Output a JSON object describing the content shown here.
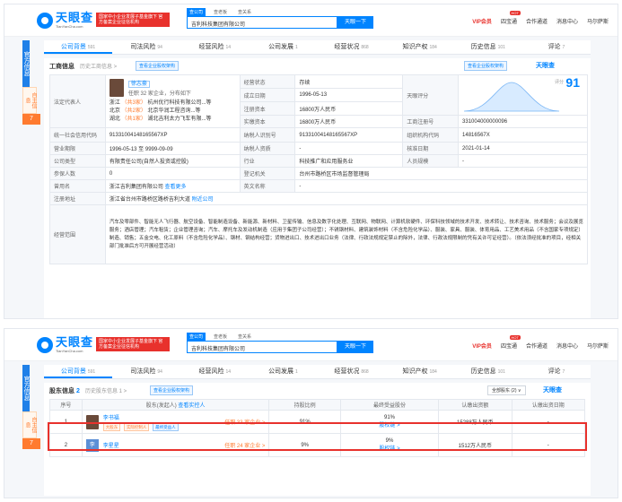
{
  "header": {
    "logo_name": "天眼查",
    "logo_domain": "TianYanCha.com",
    "promo": "国家中小企业发展子基金旗下 官方备案企业征信机构",
    "search_tabs": [
      "查公司",
      "查老板",
      "查关系"
    ],
    "search_value": "吉利科技集团有限公司",
    "search_btn": "天眼一下",
    "vip": "VIP会员",
    "nav": [
      "四宝通",
      "合作通道",
      "消息中心",
      "马尔萨斯"
    ],
    "hot": "HOT"
  },
  "side": {
    "a": "官方信息",
    "b": "自主信息",
    "c": "7"
  },
  "tabs1": [
    {
      "label": "公司背景",
      "n": "591"
    },
    {
      "label": "司法风险",
      "n": "94"
    },
    {
      "label": "经营风险",
      "n": "14"
    },
    {
      "label": "公司发展",
      "n": "1"
    },
    {
      "label": "经营状况",
      "n": "868"
    },
    {
      "label": "知识产权",
      "n": "184"
    },
    {
      "label": "历史信息",
      "n": "101"
    },
    {
      "label": "评论",
      "n": "7"
    }
  ],
  "biz": {
    "title": "工商信息",
    "history": "历史工商信息 >",
    "report_tag": "查看企业股权架构",
    "tyc": "天眼查",
    "legal_label": "法定代表人",
    "legal_name": "徐志豪",
    "legal_desc": "任职 32 家企业，分布如下",
    "legal_rows": [
      [
        "浙江",
        "（共3家）",
        "杭州优行科技有限公司...等"
      ],
      [
        "北京",
        "（共2家）",
        "北京华润工程咨询...等"
      ],
      [
        "湖北",
        "（共1家）",
        "湖北吉利太力飞车有限...等"
      ]
    ],
    "status_k": "经营状态",
    "status_v": "存续",
    "found_k": "成立日期",
    "found_v": "1996-05-13",
    "reg_cap_k": "注册资本",
    "reg_cap_v": "16800万人民币",
    "paid_cap_k": "实缴资本",
    "paid_cap_v": "16800万人民币",
    "score_k": "天眼评分",
    "score_lbl": "评分",
    "score_v": "91",
    "reg_no_k": "工商注册号",
    "reg_no_v": "331004000000096",
    "credit_k": "统一社会信用代码",
    "credit_v": "91331004148165567XP",
    "tax_k": "纳税人识别号",
    "tax_v": "91331004148165567XP",
    "org_k": "组织机构代码",
    "org_v": "14816567X",
    "term_k": "营业期限",
    "term_v": "1996-05-13 至 9999-09-09",
    "taxq_k": "纳税人资质",
    "taxq_v": "-",
    "approve_k": "核准日期",
    "approve_v": "2021-01-14",
    "type_k": "公司类型",
    "type_v": "有限责任公司(自然人投资或控股)",
    "ind_k": "行业",
    "ind_v": "科技推广和应用服务业",
    "staff_k": "人员规模",
    "staff_v": "-",
    "ins_k": "参保人数",
    "ins_v": "0",
    "auth_k": "登记机关",
    "auth_v": "台州市路桥区市场监督管理局",
    "former_k": "曾用名",
    "former_v": "浙江吉利集团有限公司",
    "former_more": "查看更多",
    "en_k": "英文名称",
    "en_v": "-",
    "addr_k": "注册地址",
    "addr_v": "浙江省台州市路桥区路桥吉利大道",
    "addr_link": "附近公司",
    "scope_k": "经营范围",
    "scope_v": "汽车及零部件、智能无人飞行器、航空设备、智能制造设备、新能源、新材料、卫星传输、信息及数字化处理、互联网、物联网、计算机软硬件、环保科技领域的技术开发、技术转让、技术咨询、技术服务；会议及展览服务；酒店管理；汽车租赁；企业管理咨询；汽车、摩托车及发动机制造（应用于集团子公司经营）；不锈钢材料、建筑装饰材料（不含危险化学品）、服装、家具、服装、体育用品、工艺美术用品（不含国家专项规定）制造、销售；五金交电、化工原料（不含危险化学品）、钢材、钢结构经营；货物进出口、技术进出口业务（法律、行政法规规定禁止的除外，法律、行政法规限制的凭有关许可证经营）。（依法须经批准的项目，经相关部门批准后方可开展经营活动）"
  },
  "shareholders": {
    "title": "股东信息",
    "count": "2",
    "history": "历史股东信息 1 >",
    "tag": "查看企业股权架构",
    "sel": "全部股东 (2) ∨",
    "tyc": "天眼查",
    "cols": [
      "序号",
      "股东(发起人)",
      "查看实控人",
      "持股比例",
      "最终受益股份",
      "认缴出资额",
      "认缴出资日期"
    ],
    "rows": [
      {
        "idx": "1",
        "name": "李书福",
        "tags": [
          "大股东",
          "实际控制人",
          "最终受益人"
        ],
        "jobs": "任职 33 家企业 >",
        "ratio": "91%",
        "benefit": "91%",
        "path": "股权链 >",
        "amount": "15288万人民币",
        "date": "-"
      },
      {
        "idx": "2",
        "name": "李星星",
        "tags": [],
        "jobs": "任职 24 家企业 >",
        "ratio": "9%",
        "benefit": "9%",
        "path": "股权链 >",
        "amount": "1512万人民币",
        "date": "-"
      }
    ]
  },
  "colors": {
    "brand": "#0084ff",
    "promo": "#e8312c",
    "accent": "#ff7b2f"
  }
}
